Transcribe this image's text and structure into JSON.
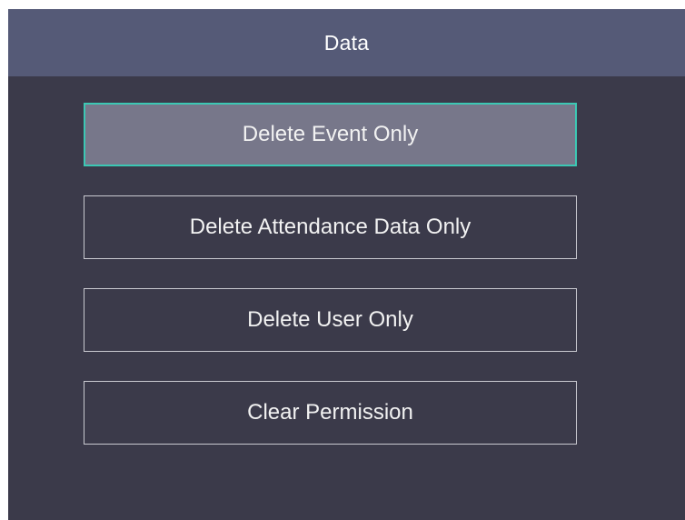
{
  "header": {
    "title": "Data"
  },
  "menu": {
    "items": [
      {
        "label": "Delete Event Only",
        "selected": true
      },
      {
        "label": "Delete Attendance Data Only",
        "selected": false
      },
      {
        "label": "Delete User Only",
        "selected": false
      },
      {
        "label": "Clear Permission",
        "selected": false
      }
    ]
  },
  "colors": {
    "background": "#3b3a4a",
    "header": "#555a77",
    "selected_fill": "#77778a",
    "selected_border": "#3cc8b4",
    "item_border": "#c9c9d0"
  }
}
